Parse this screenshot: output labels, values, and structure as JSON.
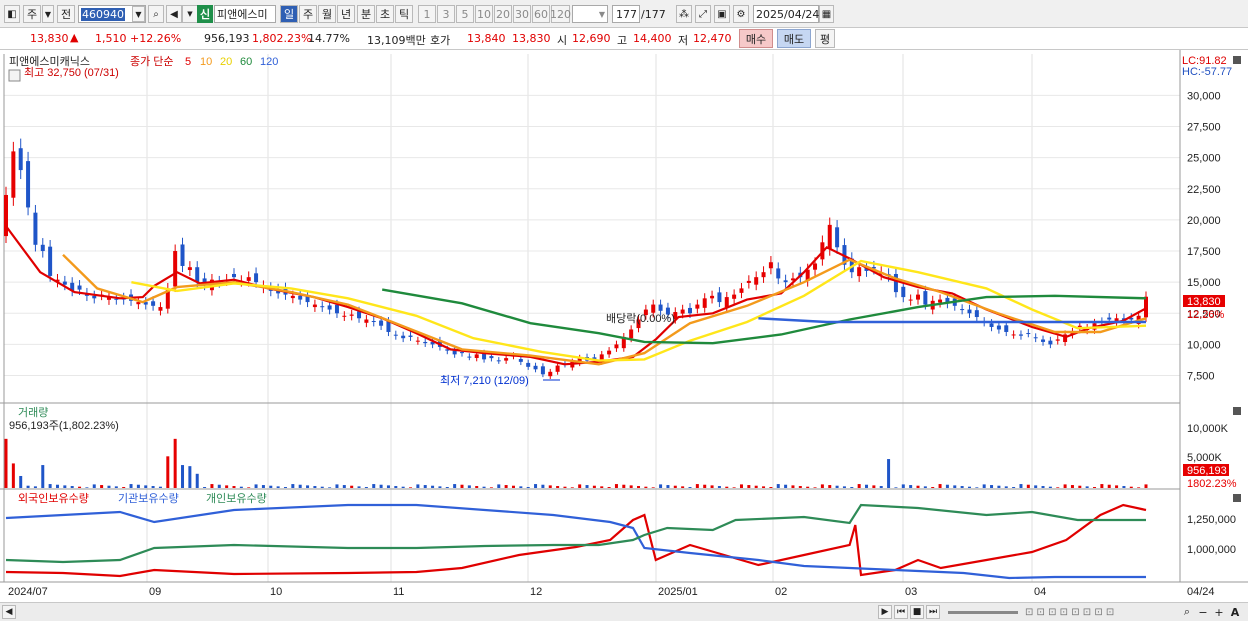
{
  "toolbar": {
    "item_type": "주",
    "prev_label": "전",
    "code": "460940",
    "name": "피앤에스미",
    "periods": [
      "일",
      "주",
      "월",
      "년",
      "분",
      "초",
      "틱"
    ],
    "selected_period": "일",
    "intervals": [
      "1",
      "3",
      "5",
      "10",
      "20",
      "30",
      "60",
      "120"
    ],
    "count_current": "177",
    "count_total": "/177",
    "date": "2025/04/24",
    "new_label": "신"
  },
  "quote": {
    "price": "13,830",
    "change": "1,510",
    "change_pct": "+12.26%",
    "volume": "956,193",
    "volume_pct": "1,802.23%",
    "turnover": "14.77%",
    "amount": "13,109백만",
    "hoga_label": "호가",
    "ask": "13,840",
    "bid": "13,830",
    "open_label": "시",
    "open": "12,690",
    "high_label": "고",
    "high": "14,400",
    "low_label": "저",
    "low": "12,470",
    "buy_label": "매수",
    "sell_label": "매도",
    "avg_label": "평"
  },
  "price_panel": {
    "stock_name": "피앤에스미캐닉스",
    "ma_label": "종가 단순",
    "ma_periods": [
      "5",
      "10",
      "20",
      "60",
      "120"
    ],
    "max_label": "최고 32,750 (07/31)",
    "min_label": "최저 7,210 (12/09)",
    "dividend_label": "배당락(0.00%)",
    "lc_label": "LC:91.82",
    "hc_label": "HC:-57.77",
    "current_price": "13,830",
    "current_pct": "12.26%",
    "y_ticks": [
      "30,000",
      "27,500",
      "25,000",
      "22,500",
      "20,000",
      "17,500",
      "15,000",
      "12,500",
      "10,000",
      "7,500"
    ]
  },
  "volume_panel": {
    "title": "거래량",
    "info": "956,193주(1,802.23%)",
    "ticks": [
      "10,000K",
      "5,000K"
    ],
    "current": "956,193",
    "current_pct": "1802.23%"
  },
  "holding_panel": {
    "legend": [
      "외국인보유수량",
      "기관보유수량",
      "개인보유수량"
    ],
    "ticks": [
      "1,250,000",
      "1,000,000"
    ]
  },
  "x_axis": {
    "labels": [
      "2024/07",
      "09",
      "10",
      "11",
      "12",
      "2025/01",
      "02",
      "03",
      "04"
    ],
    "end_label": "04/24"
  },
  "colors": {
    "up": "#e60000",
    "down": "#1f55c8",
    "ma5": "#e00000",
    "ma10": "#f39a1c",
    "ma20": "#ffe61a",
    "ma60": "#1f8a3c",
    "ma120": "#3060d8",
    "foreign": "#e00000",
    "inst": "#3060d8",
    "indiv": "#2e8b57"
  },
  "chart_data": [
    {
      "type": "candlestick",
      "title": "피앤에스미캐닉스",
      "x_range": [
        "2024/07",
        "2025/04/24"
      ],
      "ylim": [
        6500,
        33000
      ],
      "y_ticks": [
        7500,
        10000,
        12500,
        15000,
        17500,
        20000,
        22500,
        25000,
        27500,
        30000
      ],
      "series": [
        {
          "name": "5",
          "values": [
            [
              0,
              19500
            ],
            [
              0.03,
              15800
            ],
            [
              0.06,
              14200
            ],
            [
              0.1,
              13700
            ],
            [
              0.12,
              13800
            ],
            [
              0.13,
              14700
            ],
            [
              0.15,
              15800
            ],
            [
              0.17,
              14900
            ],
            [
              0.2,
              15200
            ],
            [
              0.23,
              14500
            ],
            [
              0.27,
              13800
            ],
            [
              0.3,
              13000
            ],
            [
              0.33,
              12100
            ],
            [
              0.36,
              10900
            ],
            [
              0.39,
              9600
            ],
            [
              0.42,
              9300
            ],
            [
              0.46,
              9000
            ],
            [
              0.49,
              8400
            ],
            [
              0.52,
              8600
            ],
            [
              0.55,
              9000
            ],
            [
              0.57,
              10400
            ],
            [
              0.59,
              12200
            ],
            [
              0.62,
              12500
            ],
            [
              0.65,
              13600
            ],
            [
              0.68,
              14100
            ],
            [
              0.7,
              15800
            ],
            [
              0.72,
              17800
            ],
            [
              0.74,
              16900
            ],
            [
              0.77,
              15400
            ],
            [
              0.8,
              14600
            ],
            [
              0.83,
              14100
            ],
            [
              0.86,
              12800
            ],
            [
              0.9,
              11400
            ],
            [
              0.93,
              10600
            ],
            [
              0.95,
              11300
            ],
            [
              0.98,
              11900
            ],
            [
              1,
              12900
            ]
          ]
        },
        {
          "name": "10",
          "values": [
            [
              0.05,
              17200
            ],
            [
              0.08,
              14500
            ],
            [
              0.12,
              13400
            ],
            [
              0.15,
              14600
            ],
            [
              0.2,
              15000
            ],
            [
              0.25,
              14200
            ],
            [
              0.3,
              13200
            ],
            [
              0.35,
              11400
            ],
            [
              0.4,
              9600
            ],
            [
              0.46,
              9100
            ],
            [
              0.52,
              8400
            ],
            [
              0.56,
              9300
            ],
            [
              0.6,
              11700
            ],
            [
              0.65,
              13100
            ],
            [
              0.7,
              15000
            ],
            [
              0.74,
              16800
            ],
            [
              0.78,
              15300
            ],
            [
              0.82,
              14200
            ],
            [
              0.87,
              12500
            ],
            [
              0.92,
              11000
            ],
            [
              0.96,
              11000
            ],
            [
              1,
              12100
            ]
          ]
        },
        {
          "name": "20",
          "values": [
            [
              0.11,
              15000
            ],
            [
              0.15,
              14300
            ],
            [
              0.2,
              14900
            ],
            [
              0.25,
              14500
            ],
            [
              0.3,
              13700
            ],
            [
              0.36,
              12300
            ],
            [
              0.41,
              10500
            ],
            [
              0.47,
              9400
            ],
            [
              0.52,
              8700
            ],
            [
              0.56,
              8800
            ],
            [
              0.6,
              10300
            ],
            [
              0.65,
              11800
            ],
            [
              0.7,
              13900
            ],
            [
              0.75,
              16700
            ],
            [
              0.8,
              15800
            ],
            [
              0.86,
              14500
            ],
            [
              0.9,
              12800
            ],
            [
              0.94,
              11300
            ],
            [
              1,
              11500
            ]
          ]
        },
        {
          "name": "60",
          "values": [
            [
              0.33,
              14400
            ],
            [
              0.4,
              13300
            ],
            [
              0.46,
              11700
            ],
            [
              0.52,
              10900
            ],
            [
              0.56,
              10200
            ],
            [
              0.62,
              10100
            ],
            [
              0.68,
              10800
            ],
            [
              0.74,
              12000
            ],
            [
              0.8,
              13000
            ],
            [
              0.86,
              13800
            ],
            [
              0.92,
              13900
            ],
            [
              1,
              13700
            ]
          ]
        },
        {
          "name": "120",
          "values": [
            [
              0.66,
              12100
            ],
            [
              0.72,
              11800
            ],
            [
              0.8,
              11800
            ],
            [
              0.86,
              11800
            ],
            [
              0.92,
              11800
            ],
            [
              1,
              11800
            ]
          ]
        }
      ]
    },
    {
      "type": "bar",
      "title": "거래량",
      "ylim": [
        0,
        13000000
      ],
      "y_ticks": [
        5000000,
        10000000
      ]
    },
    {
      "type": "line",
      "title": "holdings",
      "y_ticks": [
        1000000,
        1250000
      ],
      "series": [
        {
          "name": "외국인보유수량"
        },
        {
          "name": "기관보유수량"
        },
        {
          "name": "개인보유수량"
        }
      ]
    }
  ]
}
